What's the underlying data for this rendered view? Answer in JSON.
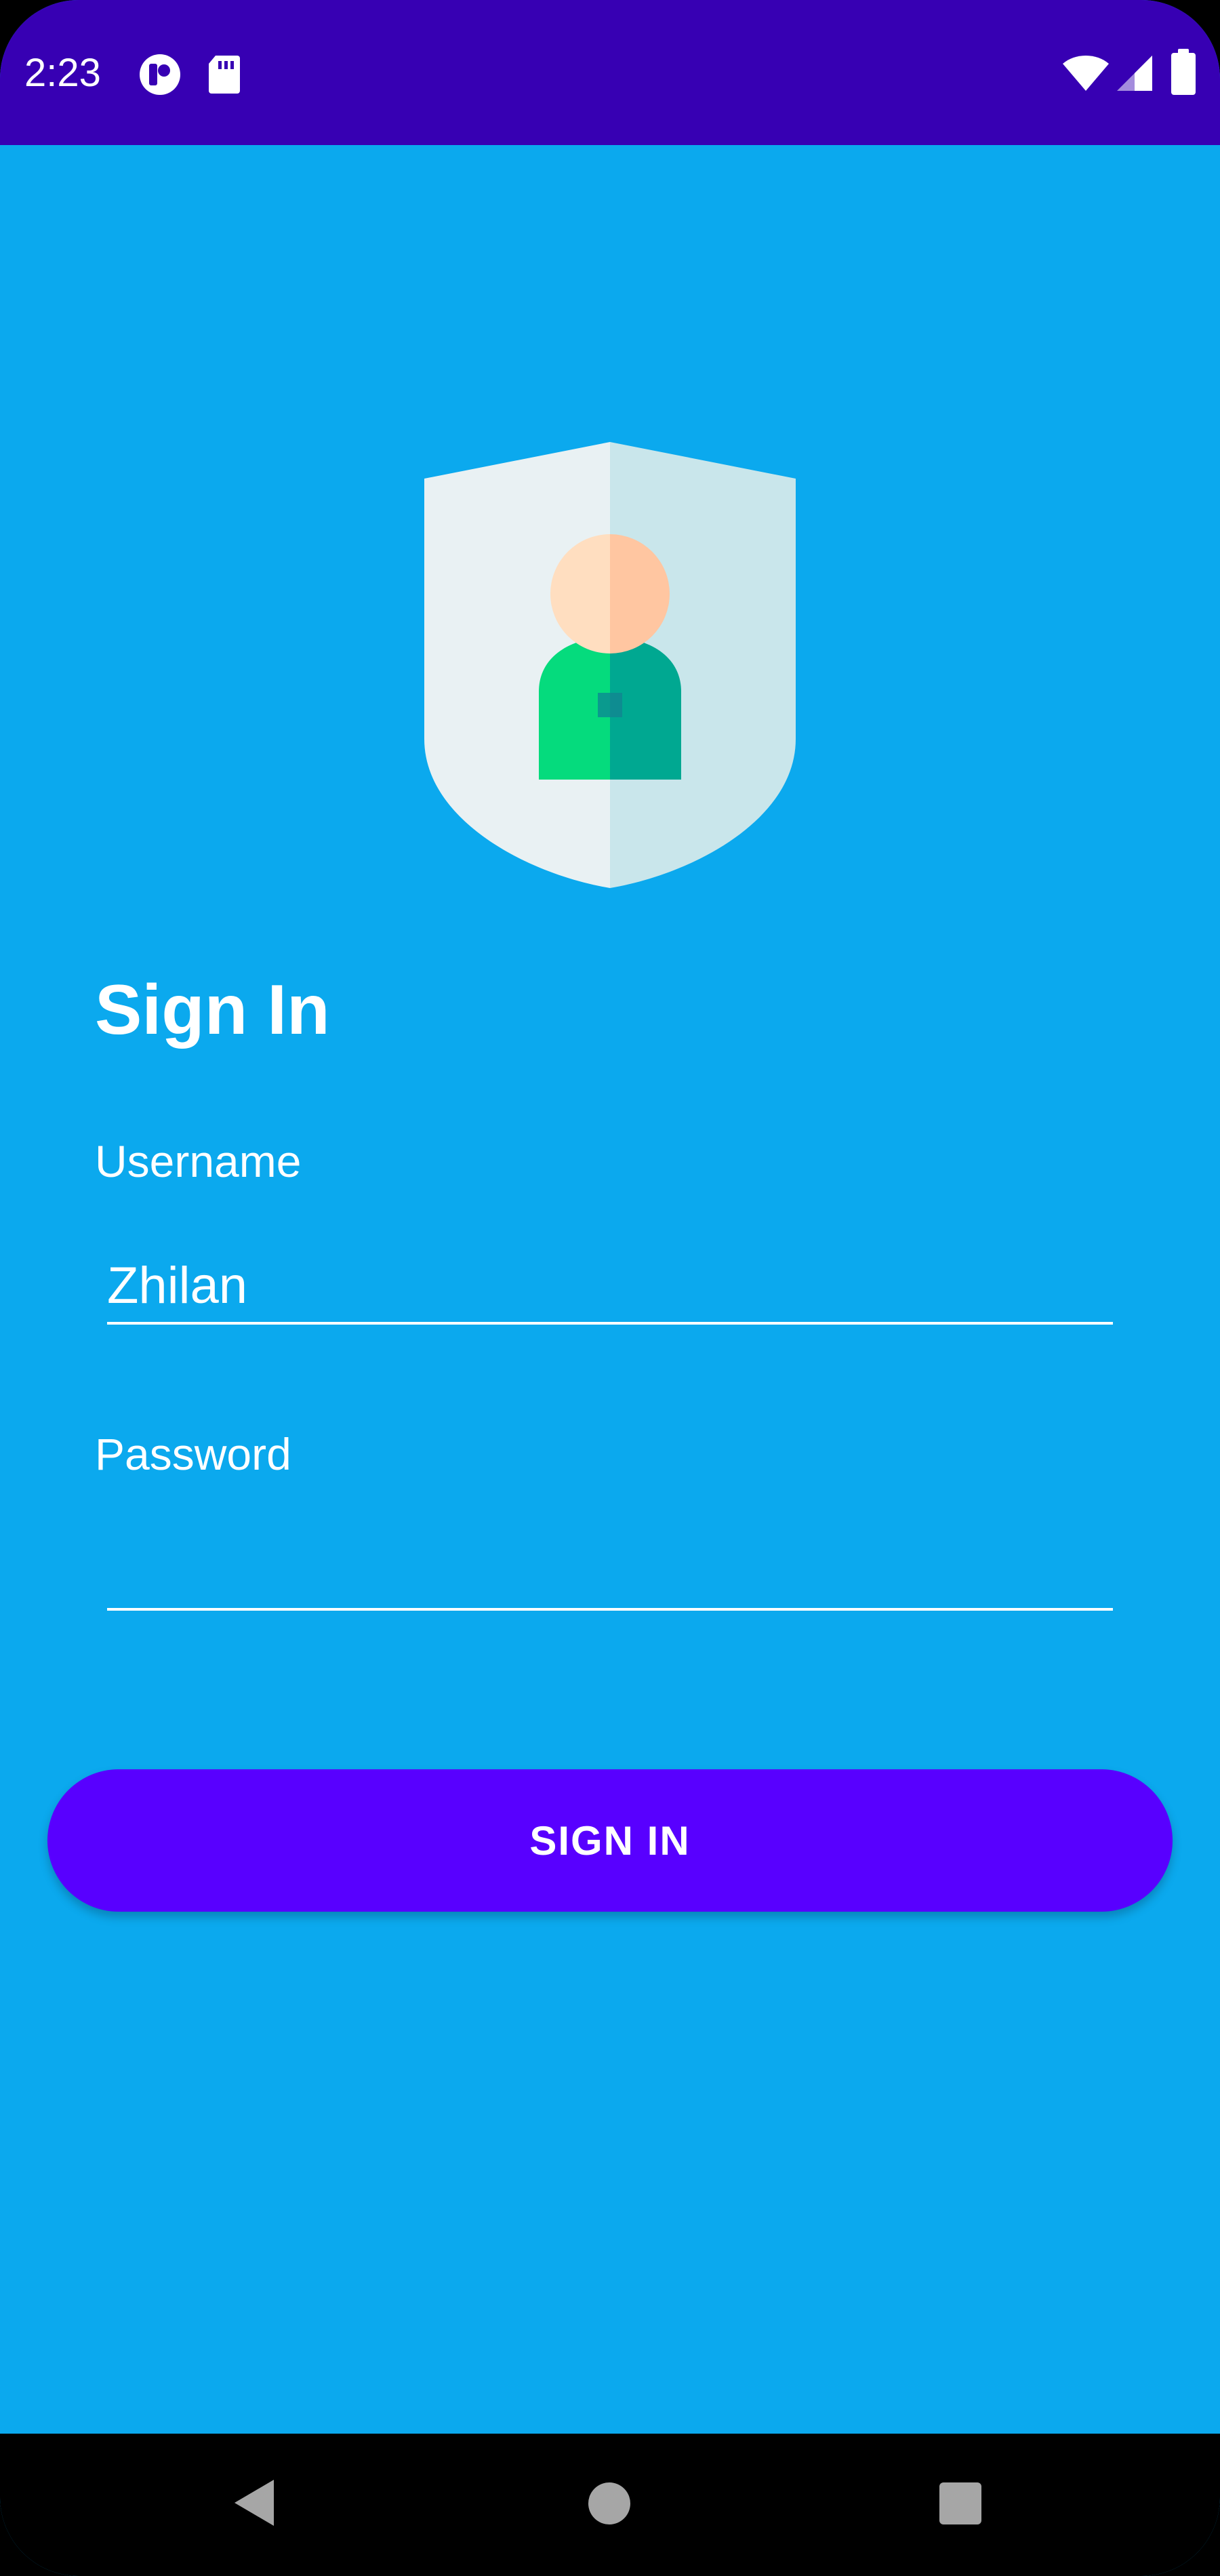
{
  "status_bar": {
    "time": "2:23",
    "icons": [
      "notification-app-icon",
      "sd-card-icon",
      "wifi-icon",
      "cellular-signal-icon",
      "battery-icon"
    ],
    "background_color": "#3700B3"
  },
  "screen": {
    "background_color": "#0BA9EE",
    "illustration": "user-shield-icon"
  },
  "form": {
    "title": "Sign In",
    "username": {
      "label": "Username",
      "value": "Zhilan",
      "placeholder": ""
    },
    "password": {
      "label": "Password",
      "value": "",
      "placeholder": ""
    },
    "submit_label": "SIGN IN",
    "submit_color": "#5800FF"
  },
  "nav_bar": {
    "icons": [
      "back-icon",
      "home-icon",
      "recents-icon"
    ]
  }
}
